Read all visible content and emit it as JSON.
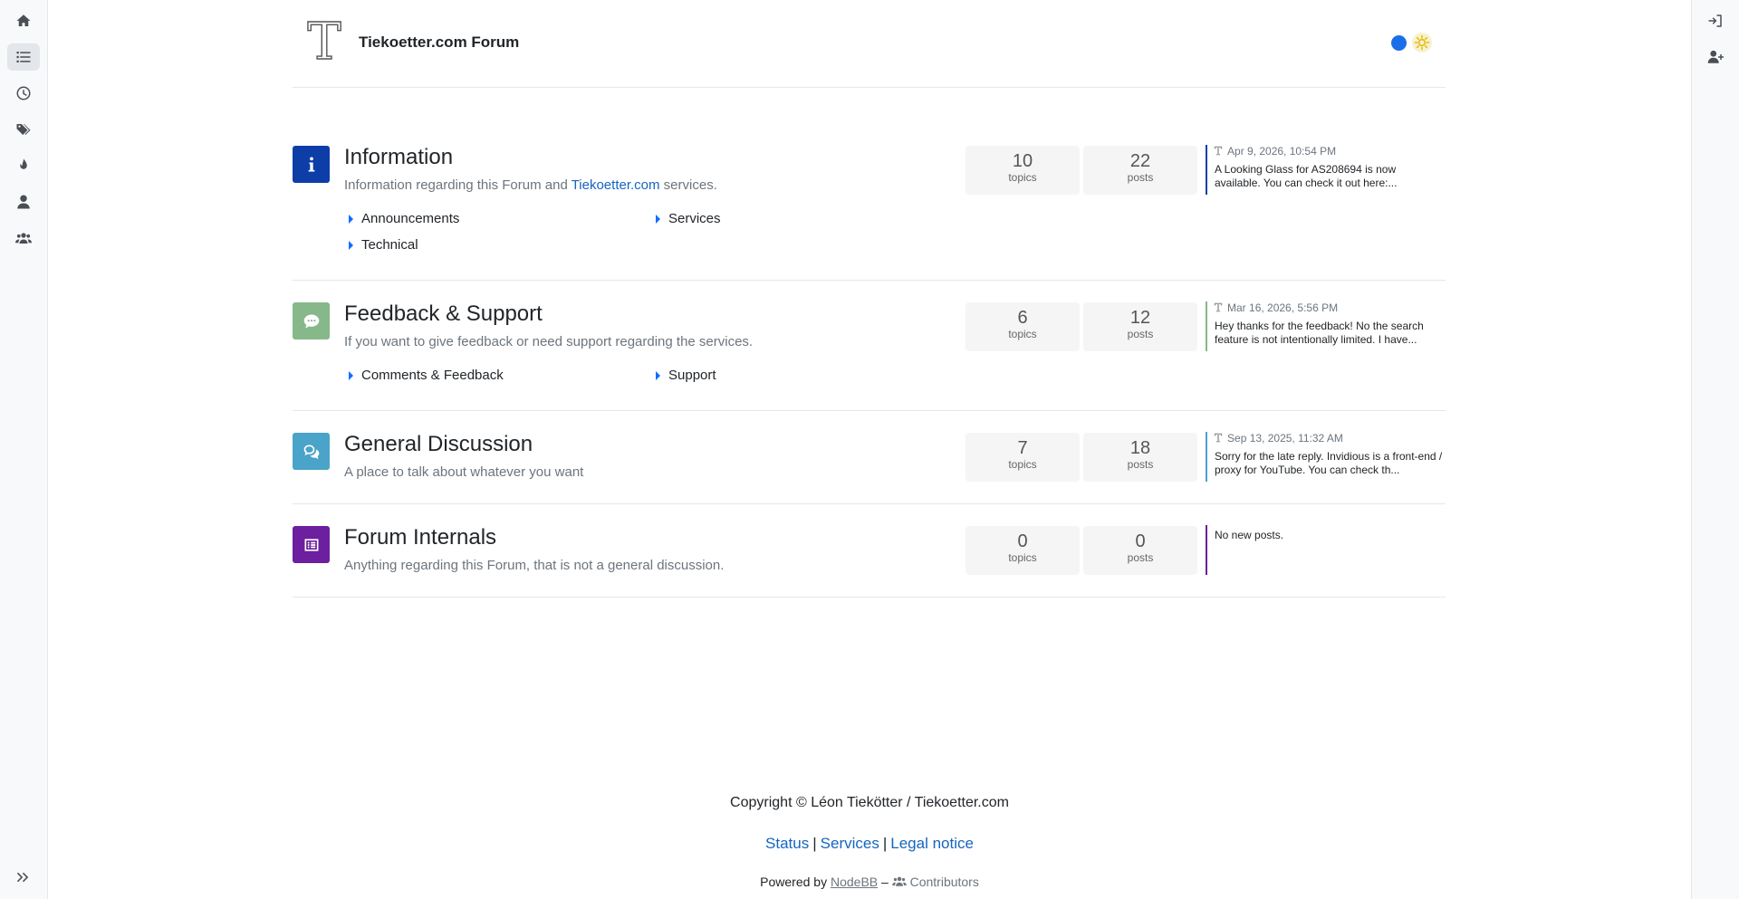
{
  "site": {
    "title": "Tiekoetter.com Forum",
    "logo_letter": "T"
  },
  "theme": {
    "dot_color": "#1a6fe8",
    "sun_color": "#e6b800"
  },
  "left_nav": [
    "home-icon",
    "list-icon",
    "clock-icon",
    "tags-icon",
    "fire-icon",
    "user-icon",
    "users-icon",
    "expand-icon"
  ],
  "right_nav": [
    "login-icon",
    "register-icon"
  ],
  "categories": [
    {
      "title": "Information",
      "desc_before": "Information regarding this Forum and ",
      "desc_link": "Tiekoetter.com",
      "desc_after": " services.",
      "color": "#0d3ea8",
      "icon": "info-icon",
      "subs": [
        "Announcements",
        "Services",
        "Technical"
      ],
      "topics": "10",
      "posts": "22",
      "topics_label": "topics",
      "posts_label": "posts",
      "teaser_date": "Apr 9, 2026, 10:54 PM",
      "teaser_text": "A Looking Glass for AS208694 is now available. You can check it out here:..."
    },
    {
      "title": "Feedback & Support",
      "desc": "If you want to give feedback or need support regarding the services.",
      "color": "#86b88a",
      "icon": "comment-dots-icon",
      "subs": [
        "Comments & Feedback",
        "Support"
      ],
      "topics": "6",
      "posts": "12",
      "topics_label": "topics",
      "posts_label": "posts",
      "teaser_date": "Mar 16, 2026, 5:56 PM",
      "teaser_text": "Hey thanks for the feedback! No the search feature is not intentionally limited. I have..."
    },
    {
      "title": "General Discussion",
      "desc": "A place to talk about whatever you want",
      "color": "#4aa3c8",
      "icon": "comments-icon",
      "topics": "7",
      "posts": "18",
      "topics_label": "topics",
      "posts_label": "posts",
      "teaser_date": "Sep 13, 2025, 11:32 AM",
      "teaser_text": "Sorry for the late reply. Invidious is a front-end / proxy for YouTube. You can check th..."
    },
    {
      "title": "Forum Internals",
      "desc": "Anything regarding this Forum, that is not a general discussion.",
      "color": "#6c1f9e",
      "icon": "list-alt-icon",
      "topics": "0",
      "posts": "0",
      "topics_label": "topics",
      "posts_label": "posts",
      "teaser_empty": "No new posts."
    }
  ],
  "footer": {
    "copyright": "Copyright © Léon Tiekötter / Tiekoetter.com",
    "links": [
      "Status",
      "Services",
      "Legal notice"
    ],
    "separator": "|",
    "powered_prefix": "Powered by ",
    "powered_link": "NodeBB",
    "powered_dash": " – ",
    "contributors": "Contributors"
  }
}
